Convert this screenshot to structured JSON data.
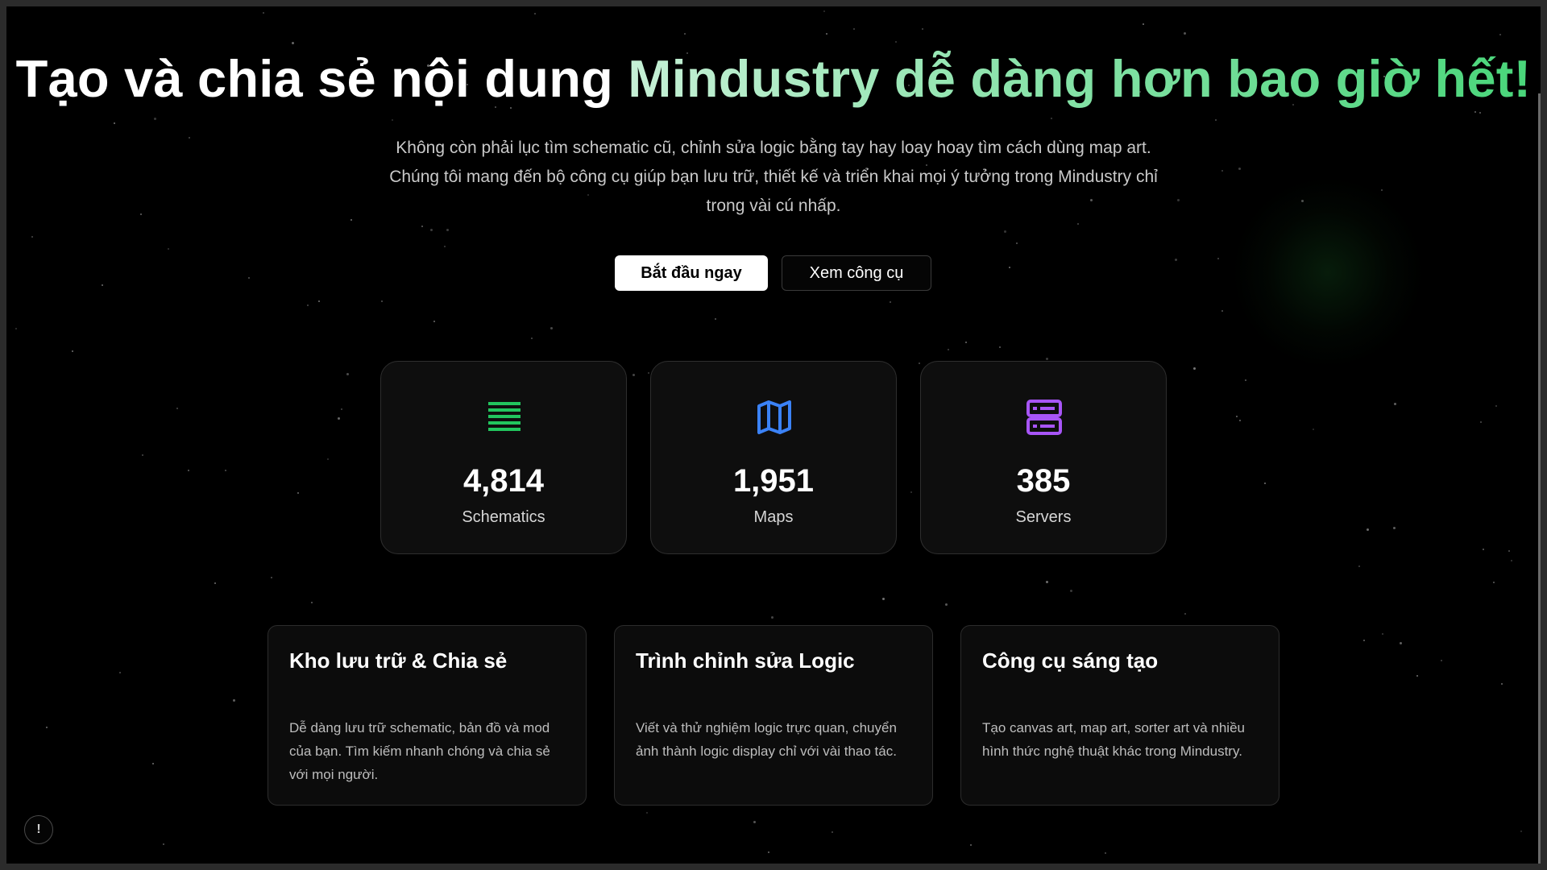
{
  "hero": {
    "title_white": "Tạo và chia sẻ nội dung ",
    "title_green": "Mindustry dễ dàng hơn bao giờ hết!",
    "subtitle": "Không còn phải lục tìm schematic cũ, chỉnh sửa logic bằng tay hay loay hoay tìm cách dùng map art. Chúng tôi mang đến bộ công cụ giúp bạn lưu trữ, thiết kế và triển khai mọi ý tưởng trong Mindustry chỉ trong vài cú nhấp."
  },
  "actions": {
    "primary_label": "Bắt đầu ngay",
    "secondary_label": "Xem công cụ"
  },
  "stats": [
    {
      "icon": "list-icon",
      "icon_color": "#22c55e",
      "value": "4,814",
      "label": "Schematics"
    },
    {
      "icon": "map-icon",
      "icon_color": "#3b82f6",
      "value": "1,951",
      "label": "Maps"
    },
    {
      "icon": "server-icon",
      "icon_color": "#a855f7",
      "value": "385",
      "label": "Servers"
    }
  ],
  "features": [
    {
      "title": "Kho lưu trữ & Chia sẻ",
      "description": "Dễ dàng lưu trữ schematic, bản đồ và mod của bạn. Tìm kiếm nhanh chóng và chia sẻ với mọi người."
    },
    {
      "title": "Trình chỉnh sửa Logic",
      "description": "Viết và thử nghiệm logic trực quan, chuyển ảnh thành logic display chỉ với vài thao tác."
    },
    {
      "title": "Công cụ sáng tạo",
      "description": "Tạo canvas art, map art, sorter art và nhiều hình thức nghệ thuật khác trong Mindustry."
    }
  ],
  "help": {
    "icon": "info-icon",
    "glyph": "!"
  },
  "colors": {
    "background": "#000000",
    "accent_green": "#49d67a",
    "card_border": "#2e2e2e"
  }
}
